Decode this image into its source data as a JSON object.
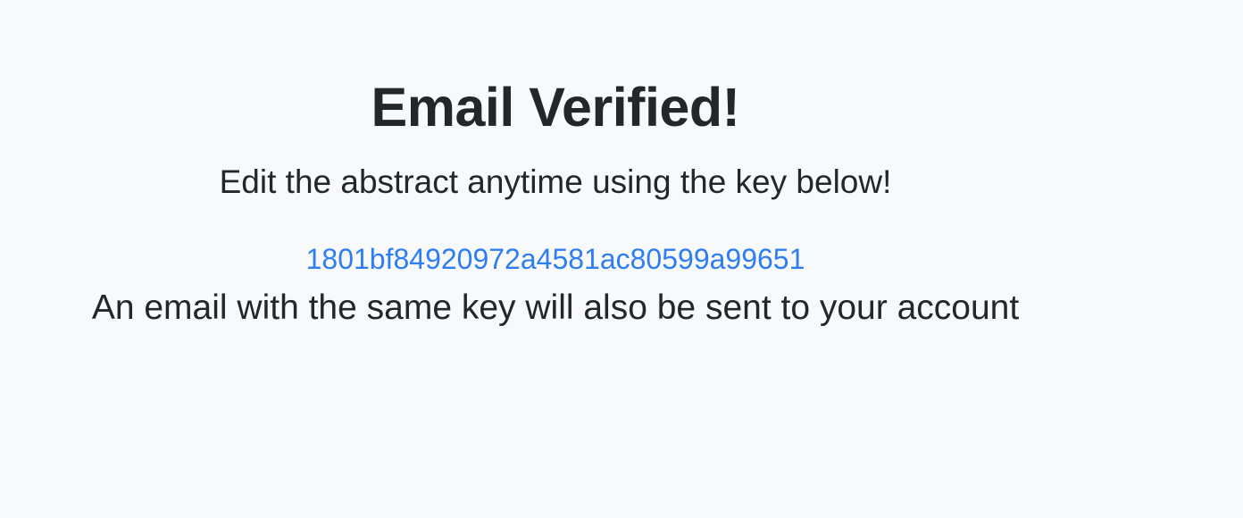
{
  "page": {
    "title": "Email Verified!",
    "subtitle": "Edit the abstract anytime using the key below!",
    "key": "1801bf84920972a4581ac80599a99651",
    "note": "An email with the same key will also be sent to your account"
  },
  "colors": {
    "background": "#f8f9fb",
    "text": "#23262b",
    "link": "#2f7df3"
  }
}
